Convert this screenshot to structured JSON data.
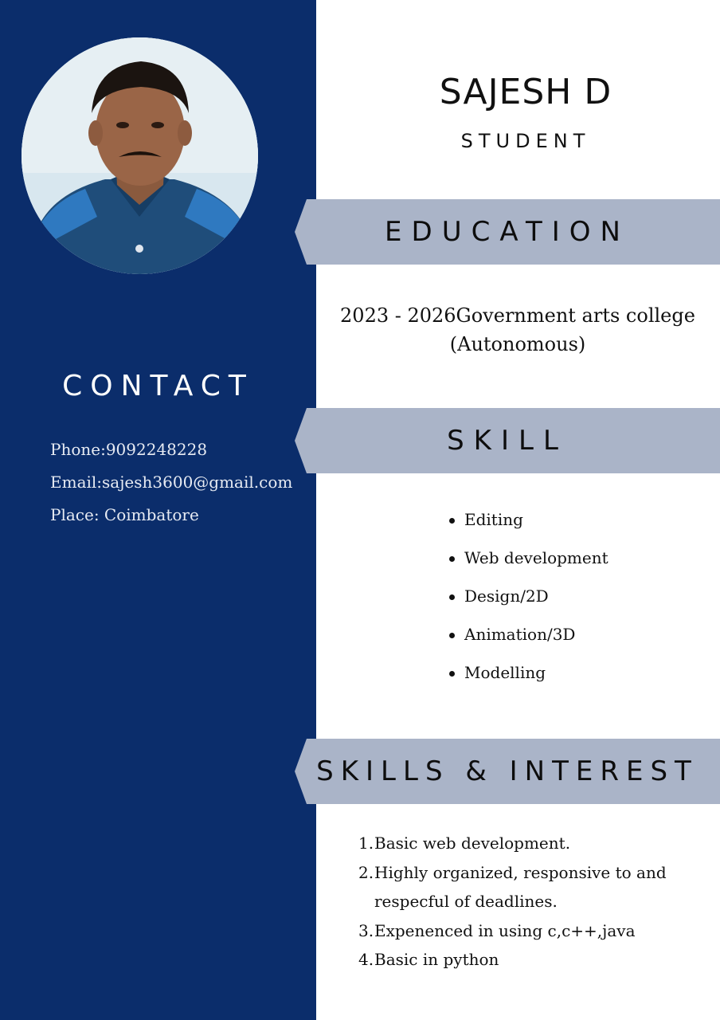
{
  "profile": {
    "name": "SAJESH D",
    "role": "STUDENT"
  },
  "contact": {
    "heading": "CONTACT",
    "phone": "Phone:9092248228",
    "email": "Email:sajesh3600@gmail.com",
    "place": "Place: Coimbatore"
  },
  "education": {
    "heading": "EDUCATION",
    "line1": "2023 - 2026Government arts college",
    "line2": "(Autonomous)"
  },
  "skill": {
    "heading": "SKILL",
    "items": [
      "Editing",
      "Web development",
      "Design/2D",
      "Animation/3D",
      "Modelling"
    ]
  },
  "skills_interest": {
    "heading": "SKILLS & INTEREST",
    "items": [
      {
        "num": "1.",
        "lines": [
          "Basic web development."
        ]
      },
      {
        "num": "2.",
        "lines": [
          "Highly organized, responsive to and",
          "respecful of deadlines."
        ]
      },
      {
        "num": "3.",
        "lines": [
          "Expenenced in using c,c++,java"
        ]
      },
      {
        "num": "4.",
        "lines": [
          "Basic in python"
        ]
      }
    ]
  },
  "colors": {
    "sidebar": "#0b2d6b",
    "banner": "#aab4c8",
    "text": "#111111"
  }
}
